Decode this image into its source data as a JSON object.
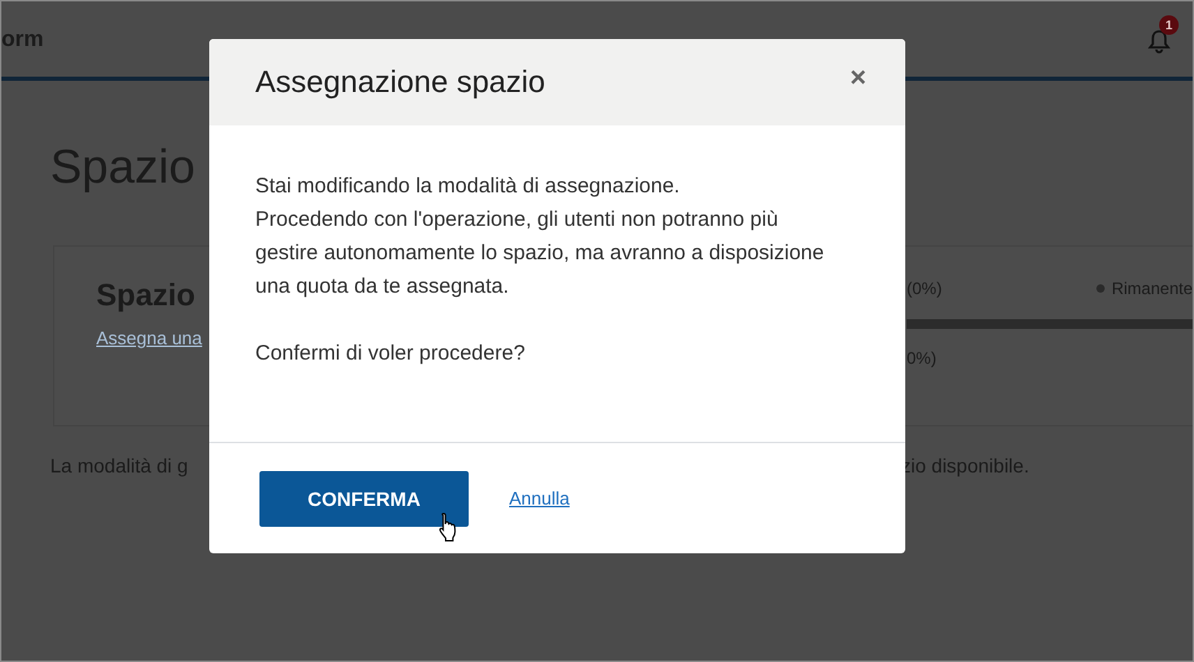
{
  "header": {
    "brand_fragment": "orm",
    "notification_count": "1"
  },
  "page": {
    "title_fragment": "Spazio",
    "card": {
      "title_fragment": "Spazio",
      "link_fragment": "Assegna una",
      "used_fragment": "(0%)",
      "legend_label": "Rimanente",
      "second_fragment": "0%)"
    },
    "footnote_fragments": [
      "La modalità di g",
      "zio disponibile."
    ]
  },
  "modal": {
    "title": "Assegnazione spazio",
    "close": "×",
    "message_lines": [
      "Stai modificando la modalità di assegnazione.",
      "Procedendo con l'operazione, gli utenti non potranno più gestire autonomamente lo spazio, ma avranno a disposizione una quota da te assegnata."
    ],
    "question": "Confermi di voler procedere?",
    "confirm_button": "CONFERMA",
    "cancel_link": "Annulla"
  }
}
